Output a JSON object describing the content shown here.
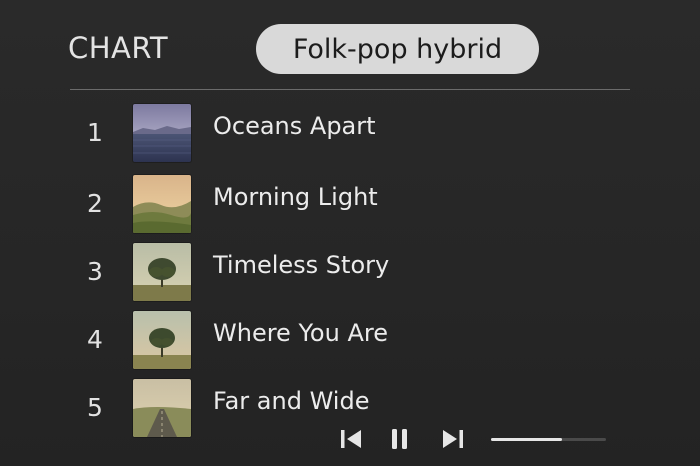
{
  "header": {
    "title": "CHART",
    "genre_pill": "Folk-pop hybrid"
  },
  "tracks": [
    {
      "rank": "1",
      "title": "Oceans Apart",
      "art": "ocean-horizon"
    },
    {
      "rank": "2",
      "title": "Morning Light",
      "art": "sunrise-hills"
    },
    {
      "rank": "3",
      "title": "Timeless Story",
      "art": "lone-tree"
    },
    {
      "rank": "4",
      "title": "Where You Are",
      "art": "lone-tree-dusk"
    },
    {
      "rank": "5",
      "title": "Far and Wide",
      "art": "open-road"
    }
  ],
  "player": {
    "previous_icon": "skip-previous-icon",
    "pause_icon": "pause-icon",
    "next_icon": "skip-next-icon",
    "progress_fraction": 0.62
  },
  "colors": {
    "background": "#262626",
    "pill_background": "#d9d9d9",
    "text": "#ebebeb"
  }
}
